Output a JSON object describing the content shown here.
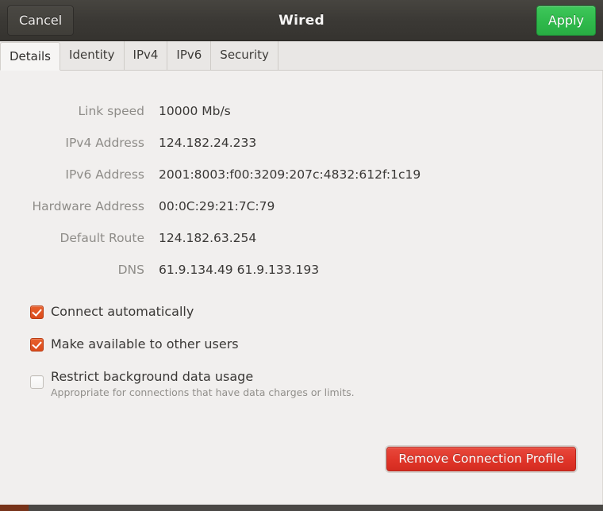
{
  "header": {
    "cancel_label": "Cancel",
    "title": "Wired",
    "apply_label": "Apply",
    "apply_color": "#2fb94b",
    "bar_color": "#3b3935"
  },
  "tabs": [
    {
      "label": "Details",
      "active": true
    },
    {
      "label": "Identity",
      "active": false
    },
    {
      "label": "IPv4",
      "active": false
    },
    {
      "label": "IPv6",
      "active": false
    },
    {
      "label": "Security",
      "active": false
    }
  ],
  "details": {
    "rows": [
      {
        "label": "Link speed",
        "value": "10000 Mb/s"
      },
      {
        "label": "IPv4 Address",
        "value": "124.182.24.233"
      },
      {
        "label": "IPv6 Address",
        "value": "2001:8003:f00:3209:207c:4832:612f:1c19"
      },
      {
        "label": "Hardware Address",
        "value": "00:0C:29:21:7C:79"
      },
      {
        "label": "Default Route",
        "value": "124.182.63.254"
      },
      {
        "label": "DNS",
        "value": "61.9.134.49 61.9.133.193"
      }
    ]
  },
  "options": [
    {
      "label": "Connect automatically",
      "checked": true,
      "subtitle": ""
    },
    {
      "label": "Make available to other users",
      "checked": true,
      "subtitle": ""
    },
    {
      "label": "Restrict background data usage",
      "checked": false,
      "subtitle": "Appropriate for connections that have data charges or limits."
    }
  ],
  "checkbox_accent": "#e0501f",
  "actions": {
    "remove_label": "Remove Connection Profile",
    "remove_color": "#e03529"
  }
}
